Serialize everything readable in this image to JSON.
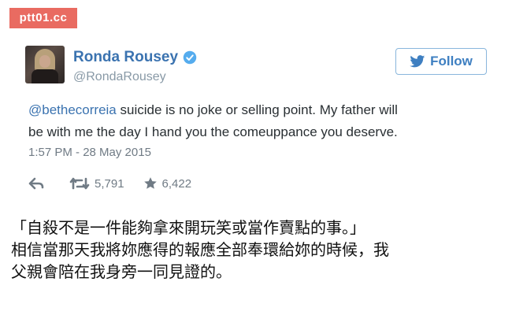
{
  "watermark": "ptt01.cc",
  "tweet": {
    "display_name": "Ronda Rousey",
    "handle": "@RondaRousey",
    "follow_label": "Follow",
    "mention": "@bethecorreia",
    "text_line1_rest": " suicide is no joke or selling point. My father will",
    "text_line2": "be with me the day I hand you the comeuppance you deserve.",
    "timestamp": "1:57 PM - 28 May 2015",
    "retweets": "5,791",
    "likes": "6,422",
    "icons": [
      "verified-badge-icon",
      "twitter-bird-icon",
      "reply-icon",
      "retweet-icon",
      "star-icon"
    ],
    "colors": {
      "name": "#3b73b0",
      "follow": "#3e7fc1",
      "verified": "#55acee",
      "muted": "#707b85"
    }
  },
  "caption": {
    "line1": "「自殺不是一件能夠拿來開玩笑或當作賣點的事。」",
    "line2": "相信當那天我將妳應得的報應全部奉環給妳的時候，我",
    "line3": "父親會陪在我身旁一同見證的。"
  }
}
